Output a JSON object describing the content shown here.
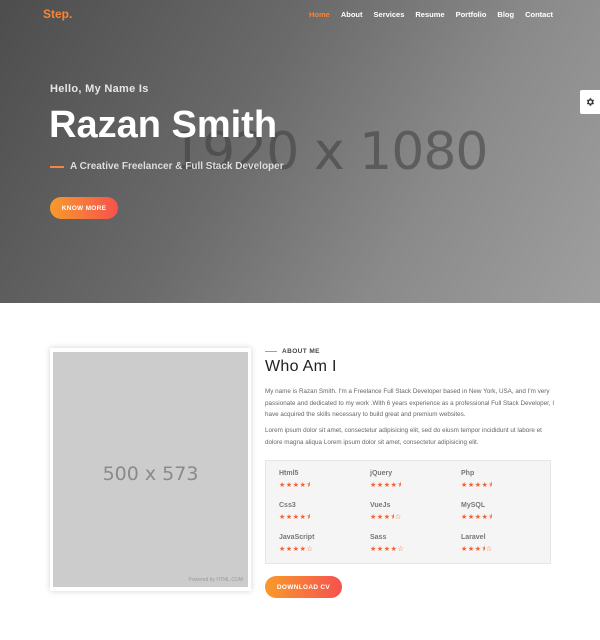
{
  "nav": {
    "logo_text": "Step",
    "logo_dot": ".",
    "menu": [
      "Home",
      "About",
      "Services",
      "Resume",
      "Portfolio",
      "Blog",
      "Contact"
    ],
    "active_item": "Home"
  },
  "hero": {
    "placeholder": "1920 x 1080",
    "greeting": "Hello, My Name Is",
    "name": "Razan Smith",
    "subtitle": "A Creative Freelancer & Full Stack Developer",
    "button_label": "KNOW MORE"
  },
  "settings": {
    "icon": "gear-icon"
  },
  "about": {
    "label": "ABOUT ME",
    "title": "Who Am I",
    "photo_placeholder": "500 x 573",
    "photo_powered": "Powered by HTML.COM",
    "paragraph_1": "My name is Razan Smith. I'm a Freelance Full Stack Developer based in New York, USA, and I'm very passionate and dedicated to my work .With 6 years experience as a professional Full Stack Developer, I have acquired the skills necessary to build great and premium websites.",
    "paragraph_2": "Lorem ipsum dolor sit amet, consectetur adipisicing elit, sed do eiusm tempor incididunt ut labore et dolore magna aliqua Lorem ipsum dolor sit amet, consectetur adipisicing elit.",
    "skills": [
      {
        "name": "Html5",
        "rating": 4.5
      },
      {
        "name": "jQuery",
        "rating": 4.5
      },
      {
        "name": "Php",
        "rating": 4.5
      },
      {
        "name": "Css3",
        "rating": 4.5
      },
      {
        "name": "VueJs",
        "rating": 3.5
      },
      {
        "name": "MySQL",
        "rating": 4.5
      },
      {
        "name": "JavaScript",
        "rating": 4
      },
      {
        "name": "Sass",
        "rating": 4
      },
      {
        "name": "Laravel",
        "rating": 3.5
      }
    ],
    "cv_button_label": "DOWNLOAD CV"
  },
  "colors": {
    "accent": "#f7853a",
    "gradient_start": "#f89a2c",
    "gradient_end": "#f6524d",
    "star": "#f6602e"
  }
}
